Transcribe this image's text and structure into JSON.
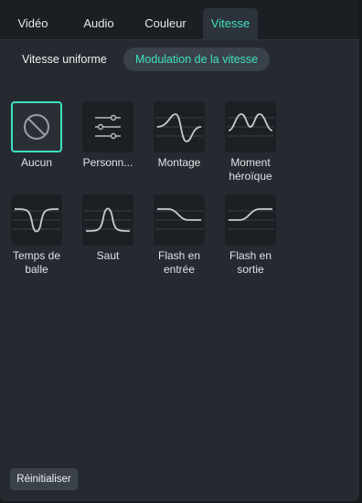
{
  "tabs": [
    {
      "label": "Vidéo"
    },
    {
      "label": "Audio"
    },
    {
      "label": "Couleur"
    },
    {
      "label": "Vitesse",
      "active": true
    }
  ],
  "subtabs": [
    {
      "label": "Vitesse uniforme"
    },
    {
      "label": "Modulation de la vitesse",
      "active": true
    }
  ],
  "presets": [
    {
      "label": "Aucun",
      "icon": "no-entry-icon",
      "selected": true
    },
    {
      "label": "Personn...",
      "icon": "sliders-icon"
    },
    {
      "label": "Montage",
      "icon": "montage-curve-icon"
    },
    {
      "label": "Moment héroïque",
      "icon": "hero-moment-curve-icon"
    },
    {
      "label": "Temps de balle",
      "icon": "bullet-time-curve-icon"
    },
    {
      "label": "Saut",
      "icon": "jump-curve-icon"
    },
    {
      "label": "Flash en entrée",
      "icon": "flash-in-curve-icon"
    },
    {
      "label": "Flash en sortie",
      "icon": "flash-out-curve-icon"
    }
  ],
  "reset_label": "Réinitialiser",
  "colors": {
    "accent": "#3ee0c1",
    "panel": "#252a31",
    "tabbar": "#1b1f24"
  }
}
